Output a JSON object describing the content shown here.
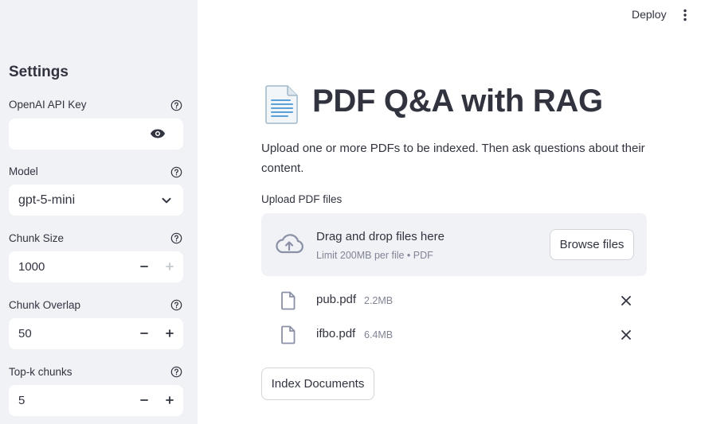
{
  "header": {
    "deploy_label": "Deploy",
    "menu_icon": "kebab-menu-icon"
  },
  "sidebar": {
    "title": "Settings",
    "fields": [
      {
        "label": "OpenAI API Key",
        "value": "",
        "type": "password",
        "icon": "eye-icon"
      },
      {
        "label": "Model",
        "value": "gpt-5-mini",
        "type": "select",
        "icon": "chevron-down-icon"
      },
      {
        "label": "Chunk Size",
        "value": "1000",
        "type": "number"
      },
      {
        "label": "Chunk Overlap",
        "value": "50",
        "type": "number"
      },
      {
        "label": "Top-k chunks",
        "value": "5",
        "type": "number"
      }
    ],
    "stepper": {
      "minus": "−",
      "plus": "+"
    }
  },
  "main": {
    "title": "PDF Q&A with RAG",
    "title_icon": "page-facing-up-emoji",
    "intro": "Upload one or more PDFs to be indexed. Then ask questions about their content.",
    "uploader": {
      "label": "Upload PDF files",
      "drop_text": "Drag and drop files here",
      "limit_text": "Limit 200MB per file • PDF",
      "browse_label": "Browse files"
    },
    "files": [
      {
        "name": "pub.pdf",
        "size": "2.2MB"
      },
      {
        "name": "ifbo.pdf",
        "size": "6.4MB"
      }
    ],
    "index_button": "Index Documents"
  },
  "colors": {
    "sidebar_bg": "#f0f2f6",
    "text": "#31333f",
    "muted": "#808495",
    "icon": "#a3a8b8",
    "border": "#d3d5db"
  }
}
